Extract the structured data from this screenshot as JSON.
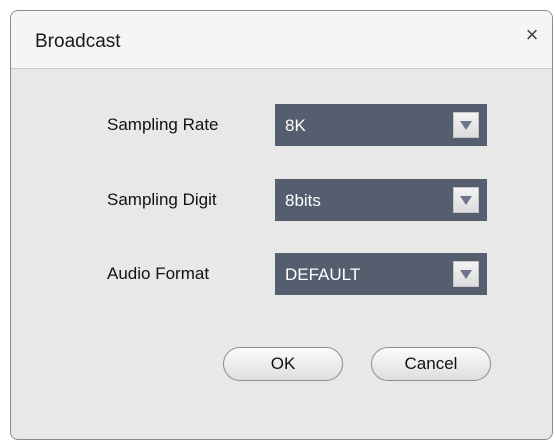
{
  "dialog": {
    "title": "Broadcast",
    "close_glyph": "×"
  },
  "fields": [
    {
      "label": "Sampling Rate",
      "value": "8K"
    },
    {
      "label": "Sampling Digit",
      "value": "8bits"
    },
    {
      "label": "Audio Format",
      "value": "DEFAULT"
    }
  ],
  "buttons": {
    "ok_label": "OK",
    "cancel_label": "Cancel"
  },
  "colors": {
    "select_bg": "#555e6f",
    "dialog_bg": "#e8e8e8",
    "titlebar_bg": "#f5f5f5"
  }
}
